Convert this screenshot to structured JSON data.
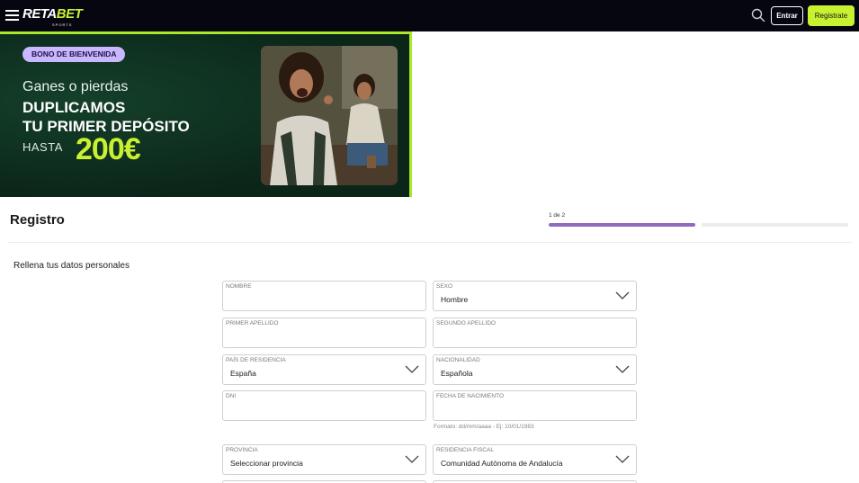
{
  "header": {
    "logo_main": "RETA",
    "logo_accent": "BET",
    "logo_sub": "SPORTS",
    "login_label": "Entrar",
    "register_label": "Registrate",
    "accent_color": "#c8f132"
  },
  "banner": {
    "badge": "BONO DE BIENVENIDA",
    "line1": "Ganes o pierdas",
    "line2": "DUPLICAMOS",
    "line3": "TU PRIMER DEPÓSITO",
    "hasta": "HASTA",
    "amount": "200€"
  },
  "page": {
    "title": "Registro",
    "step_text": "1 de 2",
    "step_current": 1,
    "step_total": 2,
    "subtitle": "Rellena tus datos personales"
  },
  "form": {
    "nombre": {
      "label": "NOMBRE",
      "value": ""
    },
    "sexo": {
      "label": "SEXO",
      "value": "Hombre"
    },
    "primer_apellido": {
      "label": "PRIMER APELLIDO",
      "value": ""
    },
    "segundo_apellido": {
      "label": "SEGUNDO APELLIDO",
      "value": ""
    },
    "pais": {
      "label": "PAÍS DE RESIDENCIA",
      "value": "España"
    },
    "nacionalidad": {
      "label": "NACIONALIDAD",
      "value": "Española"
    },
    "dni": {
      "label": "DNI",
      "value": ""
    },
    "fecha": {
      "label": "FECHA DE NACIMIENTO",
      "value": "",
      "hint": "Formato: dd/mm/aaaa - Ej: 10/01/1983"
    },
    "provincia": {
      "label": "PROVINCIA",
      "value": "Seleccionar provincia"
    },
    "residencia_fiscal": {
      "label": "RESIDENCIA FISCAL",
      "value": "Comunidad Autónoma de Andalucía"
    }
  },
  "colors": {
    "progress_active": "#8e6bbf",
    "progress_inactive": "#ececec",
    "banner_border": "#a8e92a"
  }
}
